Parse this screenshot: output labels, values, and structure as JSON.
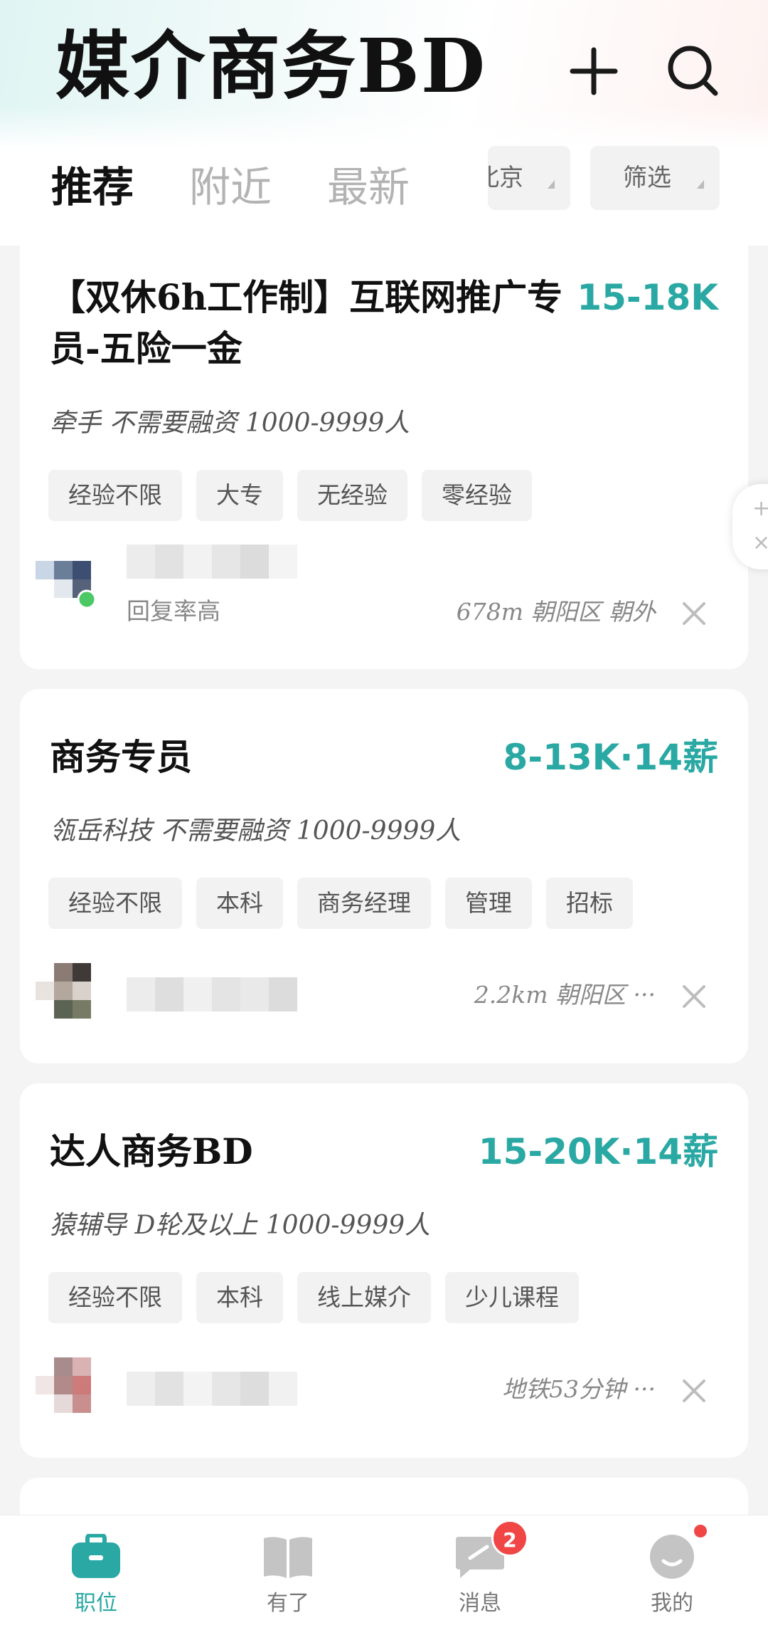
{
  "header": {
    "title": "媒介商务BD",
    "add_icon": "plus-icon",
    "search_icon": "search-icon"
  },
  "tabs": [
    {
      "label": "推荐",
      "active": true
    },
    {
      "label": "附近",
      "active": false
    },
    {
      "label": "最新",
      "active": false
    }
  ],
  "city_label": "北京",
  "filter_label": "筛选",
  "jobs": [
    {
      "title": "【双休6h工作制】互联网推广专员-五险一金",
      "salary": "15-18K",
      "company": "牵手  不需要融资  1000-9999人",
      "tags": [
        "经验不限",
        "大专",
        "无经验",
        "零经验"
      ],
      "reply": "回复率高",
      "location": "678m  朝阳区  朝外"
    },
    {
      "title": "商务专员",
      "salary": "8-13K·14薪",
      "company": "瓴岳科技  不需要融资  1000-9999人",
      "tags": [
        "经验不限",
        "本科",
        "商务经理",
        "管理",
        "招标"
      ],
      "location": "2.2km  朝阳区 ···"
    },
    {
      "title": "达人商务BD",
      "salary": "15-20K·14薪",
      "company": "猿辅导  D轮及以上  1000-9999人",
      "tags": [
        "经验不限",
        "本科",
        "线上媒介",
        "少儿课程"
      ],
      "location": "地铁53分钟 ···"
    }
  ],
  "nav": [
    {
      "label": "职位",
      "icon": "briefcase-icon",
      "active": true
    },
    {
      "label": "有了",
      "icon": "book-icon",
      "active": false
    },
    {
      "label": "消息",
      "icon": "message-icon",
      "badge": "2"
    },
    {
      "label": "我的",
      "icon": "profile-icon",
      "dot": true
    }
  ],
  "colors": {
    "accent": "#2aa8a3",
    "badge": "#f04646"
  }
}
